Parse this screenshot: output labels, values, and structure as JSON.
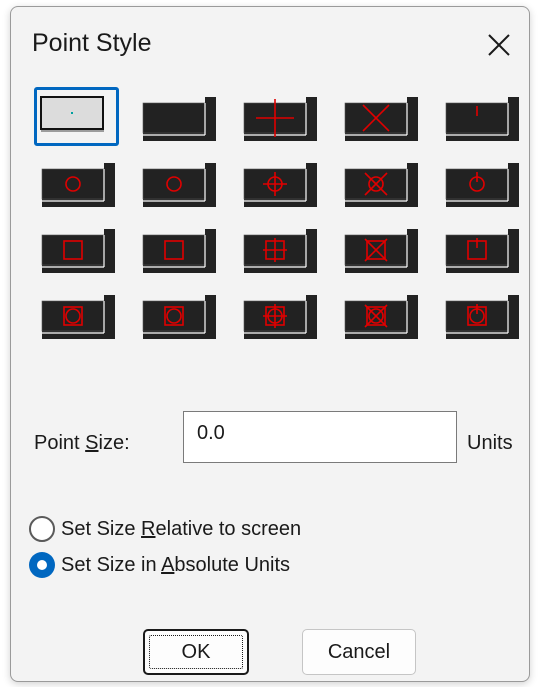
{
  "dialog": {
    "title": "Point Style",
    "close_glyph": "✕"
  },
  "styles": {
    "selected_index": 0,
    "accent_color": "#0067c0",
    "marker_color": "#e00000",
    "tile_color": "#222222",
    "rows": [
      [
        {
          "mark": "dot"
        },
        {
          "mark": "none"
        },
        {
          "mark": "plus"
        },
        {
          "mark": "x"
        },
        {
          "mark": "tick"
        }
      ],
      [
        {
          "mark": "circle"
        },
        {
          "mark": "circle"
        },
        {
          "mark": "circle-plus"
        },
        {
          "mark": "circle-x"
        },
        {
          "mark": "circle-tick"
        }
      ],
      [
        {
          "mark": "square"
        },
        {
          "mark": "square"
        },
        {
          "mark": "square-plus"
        },
        {
          "mark": "square-x"
        },
        {
          "mark": "square-tick"
        }
      ],
      [
        {
          "mark": "square-circle"
        },
        {
          "mark": "square-circle"
        },
        {
          "mark": "square-circle-plus"
        },
        {
          "mark": "square-circle-x"
        },
        {
          "mark": "square-circle-tick"
        }
      ]
    ]
  },
  "point_size": {
    "label_pre": "Point ",
    "label_underline": "S",
    "label_post": "ize:",
    "value": "0.0",
    "units_label": "Units"
  },
  "size_mode": {
    "relative": {
      "pre": "Set Size ",
      "underline": "R",
      "post": "elative to screen",
      "checked": false
    },
    "absolute": {
      "pre": "Set Size in ",
      "underline": "A",
      "post": "bsolute Units",
      "checked": true
    }
  },
  "buttons": {
    "ok_label": "OK",
    "cancel_label": "Cancel"
  }
}
